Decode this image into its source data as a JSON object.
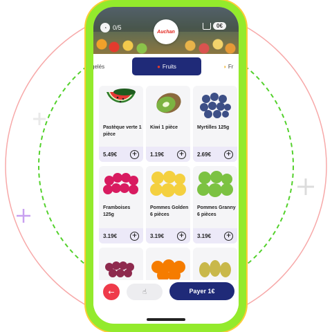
{
  "header": {
    "counter": "0/5",
    "store_logo": "Auchan",
    "cart_amount": "0€"
  },
  "tabs": [
    {
      "label": "gelés",
      "icon": ""
    },
    {
      "label": "Fruits",
      "icon": "apple-icon",
      "active": true
    },
    {
      "label": "Fr",
      "icon": "fruit-icon"
    }
  ],
  "products": [
    {
      "name": "Pastèque verte 1 pièce",
      "price": "5.49€",
      "image": "watermelon"
    },
    {
      "name": "Kiwi 1 pièce",
      "price": "1.19€",
      "image": "kiwi"
    },
    {
      "name": "Myrtilles 125g",
      "price": "2.69€",
      "image": "blueberries"
    },
    {
      "name": "Framboises 125g",
      "price": "3.19€",
      "image": "raspberries"
    },
    {
      "name": "Pommes Golden 6 pièces",
      "price": "3.19€",
      "image": "golden-apples"
    },
    {
      "name": "Pommes Granny 6 pièces",
      "price": "3.19€",
      "image": "granny-apples"
    },
    {
      "name": "",
      "price": "",
      "image": "grapes"
    },
    {
      "name": "",
      "price": "",
      "image": "oranges"
    },
    {
      "name": "",
      "price": "",
      "image": "pears"
    }
  ],
  "footer": {
    "pay_label": "Payer 1€",
    "back_icon": "arrow-left-icon",
    "middle_icon": "hand-pointer-icon"
  },
  "colors": {
    "phone_frame": "#93ea2c",
    "primary": "#1f2a78",
    "back_button": "#ef3b4a",
    "price_bar": "#ece9f8"
  }
}
